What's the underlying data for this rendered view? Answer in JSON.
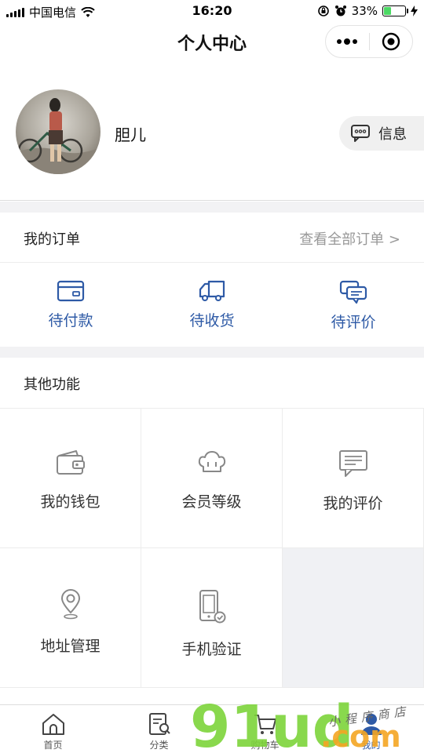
{
  "status_bar": {
    "carrier": "中国电信",
    "time": "16:20",
    "battery_percent": "33%",
    "battery_level": 0.33
  },
  "nav": {
    "title": "个人中心"
  },
  "profile": {
    "user_name": "胆儿",
    "info_button_label": "信息"
  },
  "orders": {
    "title": "我的订单",
    "view_all_label": "查看全部订单 >",
    "items": [
      {
        "label": "待付款",
        "icon": "card-icon"
      },
      {
        "label": "待收货",
        "icon": "truck-icon"
      },
      {
        "label": "待评价",
        "icon": "comment-icon"
      }
    ]
  },
  "functions": {
    "title": "其他功能",
    "items": [
      {
        "label": "我的钱包",
        "icon": "wallet-icon"
      },
      {
        "label": "会员等级",
        "icon": "crown-icon"
      },
      {
        "label": "我的评价",
        "icon": "message-icon"
      },
      {
        "label": "地址管理",
        "icon": "location-pin-icon"
      },
      {
        "label": "手机验证",
        "icon": "phone-verify-icon"
      }
    ]
  },
  "tabs": [
    {
      "label": "首页",
      "icon": "home-icon"
    },
    {
      "label": "分类",
      "icon": "category-search-icon"
    },
    {
      "label": "购物车",
      "icon": "cart-icon"
    },
    {
      "label": "我的",
      "icon": "user-icon",
      "active": true
    }
  ],
  "watermark": {
    "brand": "91ud",
    "suffix": ".com",
    "tagline": "小程序商店"
  },
  "colors": {
    "accent_blue": "#2e5aa6",
    "grey_text": "#999999",
    "watermark_green": "#7dd43a",
    "watermark_orange": "#f5a623"
  }
}
